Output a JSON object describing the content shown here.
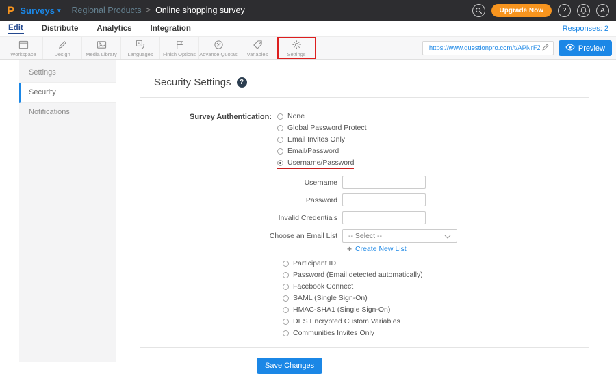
{
  "colors": {
    "accent": "#1b87e6",
    "orange": "#f7941e",
    "annotation_red": "#c71f1f",
    "topbar_bg": "#2d2d30"
  },
  "topbar": {
    "logo_letter": "P",
    "product_label": "Surveys",
    "caret": "▾",
    "breadcrumb_parent": "Regional Products",
    "breadcrumb_separator": ">",
    "breadcrumb_current": "Online shopping survey",
    "upgrade_label": "Upgrade Now",
    "help_glyph": "?",
    "avatar_letter": "A"
  },
  "nav": {
    "tabs": [
      {
        "label": "Edit",
        "active": true
      },
      {
        "label": "Distribute",
        "active": false
      },
      {
        "label": "Analytics",
        "active": false
      },
      {
        "label": "Integration",
        "active": false
      }
    ],
    "responses_label": "Responses: 2"
  },
  "toolbar": {
    "items": [
      {
        "label": "Workspace",
        "icon": "workspace-icon",
        "highlighted": false
      },
      {
        "label": "Design",
        "icon": "design-icon",
        "highlighted": false
      },
      {
        "label": "Media Library",
        "icon": "media-library-icon",
        "highlighted": false
      },
      {
        "label": "Languages",
        "icon": "languages-icon",
        "highlighted": false
      },
      {
        "label": "Finish Options",
        "icon": "finish-options-icon",
        "highlighted": false
      },
      {
        "label": "Advance Quotas",
        "icon": "advance-quotas-icon",
        "highlighted": false
      },
      {
        "label": "Variables",
        "icon": "variables-icon",
        "highlighted": false
      },
      {
        "label": "Settings",
        "icon": "settings-icon",
        "highlighted": true
      }
    ],
    "url_value": "https://www.questionpro.com/t/APNrFZ",
    "preview_label": "Preview"
  },
  "sidebar": {
    "items": [
      {
        "label": "Settings",
        "active": false
      },
      {
        "label": "Security",
        "active": true
      },
      {
        "label": "Notifications",
        "active": false
      }
    ]
  },
  "security": {
    "title": "Security Settings",
    "help_glyph": "?",
    "auth_label": "Survey Authentication:",
    "auth_options_primary": [
      {
        "label": "None",
        "selected": false,
        "underlined": false
      },
      {
        "label": "Global Password Protect",
        "selected": false,
        "underlined": false
      },
      {
        "label": "Email Invites Only",
        "selected": false,
        "underlined": false
      },
      {
        "label": "Email/Password",
        "selected": false,
        "underlined": false
      },
      {
        "label": "Username/Password",
        "selected": true,
        "underlined": true
      }
    ],
    "fields": {
      "username": {
        "label": "Username",
        "value": ""
      },
      "password": {
        "label": "Password",
        "value": ""
      },
      "invalid_credentials": {
        "label": "Invalid Credentials",
        "value": ""
      },
      "email_list": {
        "label": "Choose an Email List",
        "value": "-- Select --"
      }
    },
    "create_list": {
      "plus": "+",
      "label": "Create New List"
    },
    "auth_options_secondary": [
      {
        "label": "Participant ID",
        "selected": false,
        "underlined": false
      },
      {
        "label": "Password (Email detected automatically)",
        "selected": false,
        "underlined": false
      },
      {
        "label": "Facebook Connect",
        "selected": false,
        "underlined": false
      },
      {
        "label": "SAML (Single Sign-On)",
        "selected": false,
        "underlined": false
      },
      {
        "label": "HMAC-SHA1 (Single Sign-On)",
        "selected": false,
        "underlined": false
      },
      {
        "label": "DES Encrypted Custom Variables",
        "selected": false,
        "underlined": false
      },
      {
        "label": "Communities Invites Only",
        "selected": false,
        "underlined": false
      }
    ],
    "save_label": "Save Changes"
  }
}
